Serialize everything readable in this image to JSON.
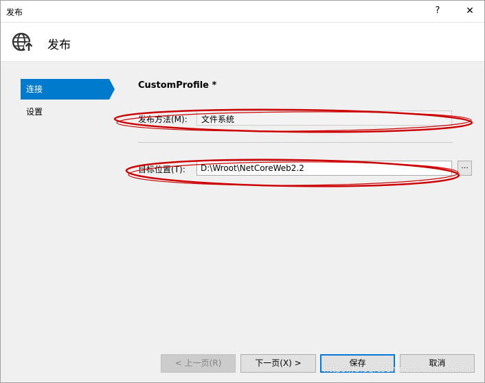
{
  "window": {
    "title": "发布",
    "help": "?",
    "close": "✕"
  },
  "header": {
    "title": "发布",
    "icon": "globe-publish-icon"
  },
  "sidebar": {
    "items": [
      {
        "label": "连接",
        "active": true
      },
      {
        "label": "设置",
        "active": false
      }
    ]
  },
  "main": {
    "profile_name": "CustomProfile *",
    "publish_method": {
      "label": "发布方法(M):",
      "value": "文件系统"
    },
    "target_location": {
      "label": "目标位置(T):",
      "value": "D:\\Wroot\\NetCoreWeb2.2",
      "browse": "..."
    }
  },
  "footer": {
    "prev": "< 上一页(R)",
    "next": "下一页(X) >",
    "save": "保存",
    "cancel": "取消"
  },
  "watermark": "https://blog.csdn.net/u011303670",
  "colors": {
    "accent": "#007acc",
    "annotation": "#cc0000"
  }
}
